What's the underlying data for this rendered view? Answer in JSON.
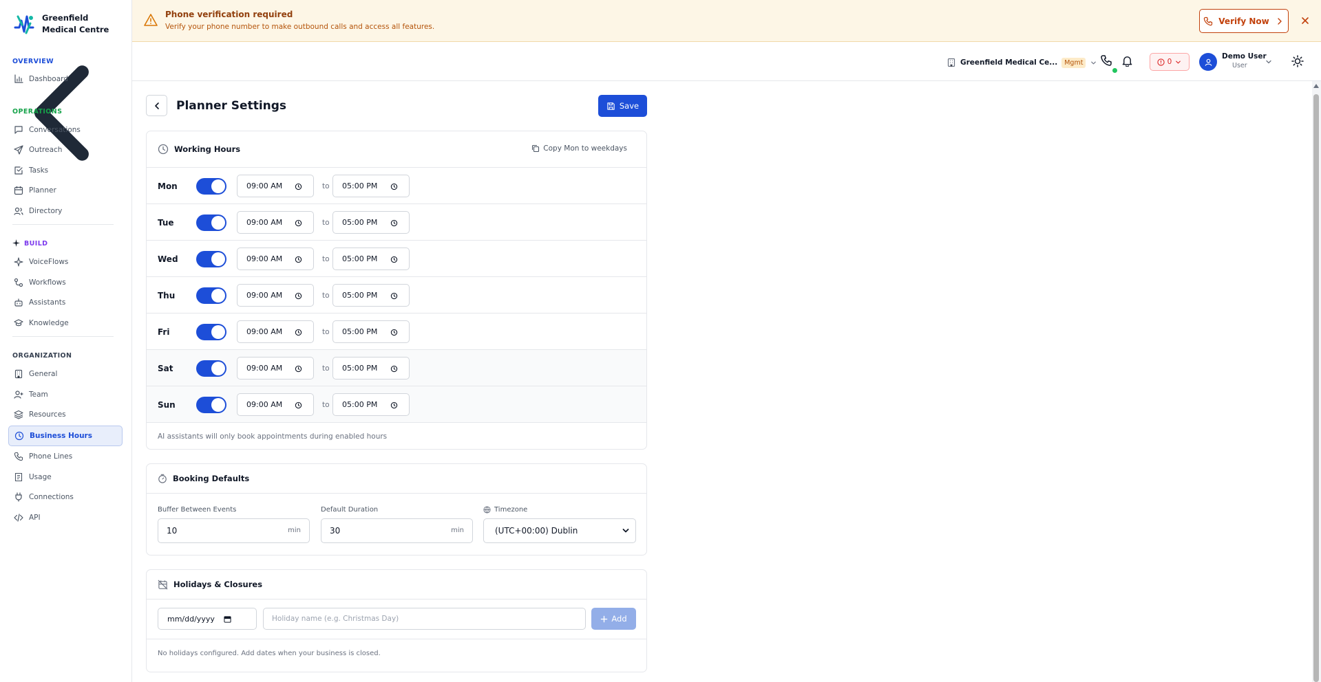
{
  "brand": {
    "name": "Greenfield Medical Centre"
  },
  "sidebar": {
    "sections": [
      {
        "title": "OVERVIEW",
        "color": "#1d4ed8"
      },
      {
        "title": "OPERATIONS",
        "color": "#16a34a"
      },
      {
        "title": "BUILD",
        "color": "#7c3aed"
      },
      {
        "title": "ORGANIZATION",
        "color": "#374151"
      }
    ],
    "items": [
      {
        "label": "Dashboard",
        "icon": "bar-chart-icon"
      },
      {
        "label": "Conversations",
        "icon": "message-square-icon"
      },
      {
        "label": "Outreach",
        "icon": "send-icon"
      },
      {
        "label": "Tasks",
        "icon": "check-square-icon"
      },
      {
        "label": "Planner",
        "icon": "calendar-icon"
      },
      {
        "label": "Directory",
        "icon": "users-icon"
      },
      {
        "label": "VoiceFlows",
        "icon": "sparkle-icon"
      },
      {
        "label": "Workflows",
        "icon": "workflow-icon"
      },
      {
        "label": "Assistants",
        "icon": "bot-icon"
      },
      {
        "label": "Knowledge",
        "icon": "graduation-cap-icon"
      },
      {
        "label": "General",
        "icon": "building-icon"
      },
      {
        "label": "Team",
        "icon": "user-plus-icon"
      },
      {
        "label": "Resources",
        "icon": "layers-icon"
      },
      {
        "label": "Business Hours",
        "icon": "clock-icon",
        "active": true
      },
      {
        "label": "Phone Lines",
        "icon": "phone-icon"
      },
      {
        "label": "Usage",
        "icon": "receipt-icon"
      },
      {
        "label": "Connections",
        "icon": "plug-icon"
      },
      {
        "label": "API",
        "icon": "code-icon"
      }
    ]
  },
  "banner": {
    "title": "Phone verification required",
    "subtitle": "Verify your phone number to make outbound calls and access all features.",
    "verify_label": "Verify Now"
  },
  "header": {
    "org_name": "Greenfield Medical Ce...",
    "org_badge": "Mgmt",
    "error_count": "0",
    "user_name": "Demo User",
    "user_role": "User"
  },
  "page": {
    "title": "Planner Settings",
    "save_label": "Save"
  },
  "working_hours": {
    "title": "Working Hours",
    "copy_label": "Copy Mon to weekdays",
    "to_label": "to",
    "days": [
      {
        "day": "Mon",
        "enabled": true,
        "start": "09:00 AM",
        "end": "05:00 PM"
      },
      {
        "day": "Tue",
        "enabled": true,
        "start": "09:00 AM",
        "end": "05:00 PM"
      },
      {
        "day": "Wed",
        "enabled": true,
        "start": "09:00 AM",
        "end": "05:00 PM"
      },
      {
        "day": "Thu",
        "enabled": true,
        "start": "09:00 AM",
        "end": "05:00 PM"
      },
      {
        "day": "Fri",
        "enabled": true,
        "start": "09:00 AM",
        "end": "05:00 PM"
      },
      {
        "day": "Sat",
        "enabled": true,
        "start": "09:00 AM",
        "end": "05:00 PM"
      },
      {
        "day": "Sun",
        "enabled": true,
        "start": "09:00 AM",
        "end": "05:00 PM"
      }
    ],
    "note": "AI assistants will only book appointments during enabled hours"
  },
  "booking": {
    "title": "Booking Defaults",
    "buffer_label": "Buffer Between Events",
    "buffer_value": "10",
    "buffer_unit": "min",
    "duration_label": "Default Duration",
    "duration_value": "30",
    "duration_unit": "min",
    "timezone_label": "Timezone",
    "timezone_value": "(UTC+00:00) Dublin"
  },
  "holidays": {
    "title": "Holidays & Closures",
    "date_placeholder": "mm/dd/yyyy",
    "name_placeholder": "Holiday name (e.g. Christmas Day)",
    "add_label": "Add",
    "empty_text": "No holidays configured. Add dates when your business is closed."
  },
  "colors": {
    "primary": "#1d4ed8",
    "warning_bg": "#fdf6e6",
    "warning_text": "#b45309",
    "danger": "#dc2626",
    "online": "#22c55e"
  }
}
